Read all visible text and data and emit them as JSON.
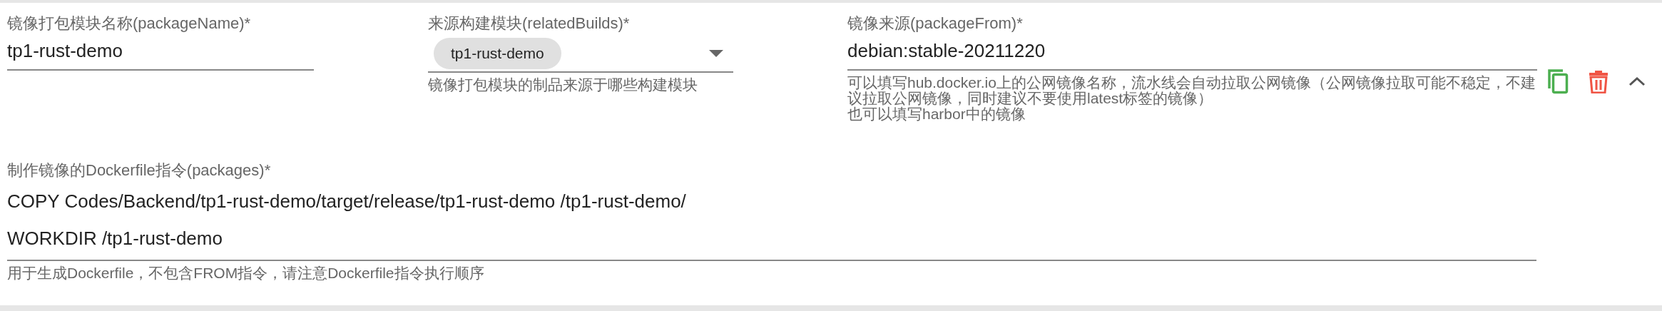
{
  "package_name": {
    "label": "镜像打包模块名称(packageName)*",
    "value": "tp1-rust-demo"
  },
  "related_builds": {
    "label": "来源构建模块(relatedBuilds)*",
    "chips": [
      "tp1-rust-demo"
    ],
    "hint": "镜像打包模块的制品来源于哪些构建模块"
  },
  "package_from": {
    "label": "镜像来源(packageFrom)*",
    "value": "debian:stable-20211220",
    "hint_lines": [
      "可以填写hub.docker.io上的公网镜像名称，流水线会自动拉取公网镜像（公网镜像拉取可能不稳定，不建议拉取公网镜像，同时建议不要使用latest标签的镜像）",
      "也可以填写harbor中的镜像"
    ]
  },
  "packages": {
    "label": "制作镜像的Dockerfile指令(packages)*",
    "lines": [
      "COPY Codes/Backend/tp1-rust-demo/target/release/tp1-rust-demo /tp1-rust-demo/",
      "WORKDIR /tp1-rust-demo"
    ],
    "hint": "用于生成Dockerfile，不包含FROM指令，请注意Dockerfile指令执行顺序"
  }
}
